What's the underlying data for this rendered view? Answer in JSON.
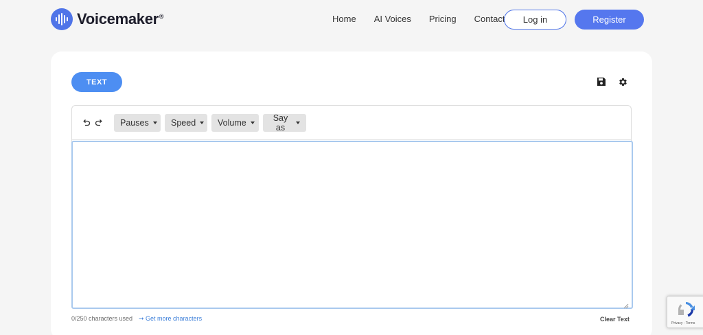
{
  "brand": {
    "name": "Voicemaker",
    "reg_mark": "®",
    "logo_icon": "sound-wave-icon",
    "accent": "#4f74e8"
  },
  "nav": {
    "items": [
      {
        "label": "Home"
      },
      {
        "label": "AI Voices"
      },
      {
        "label": "Pricing"
      },
      {
        "label": "Contact"
      }
    ],
    "login_label": "Log in",
    "register_label": "Register"
  },
  "editor": {
    "mode_label": "TEXT",
    "save_icon": "save-icon",
    "settings_icon": "gear-icon",
    "undo_icon": "undo-icon",
    "redo_icon": "redo-icon",
    "dropdowns": [
      {
        "label": "Pauses"
      },
      {
        "label": "Speed"
      },
      {
        "label": "Volume"
      },
      {
        "label": "Say as"
      }
    ],
    "text_value": "",
    "char_count": "0/250 characters used",
    "more_chars_label": "➞ Get more characters",
    "clear_label": "Clear Text"
  },
  "recaptcha": {
    "footer": "Privacy - Terms"
  },
  "colors": {
    "primary_button": "#4d8ef2",
    "register_button": "#5577ee",
    "background": "#f5f5f5",
    "card": "#ffffff",
    "textarea_border": "#a9c9ee"
  }
}
